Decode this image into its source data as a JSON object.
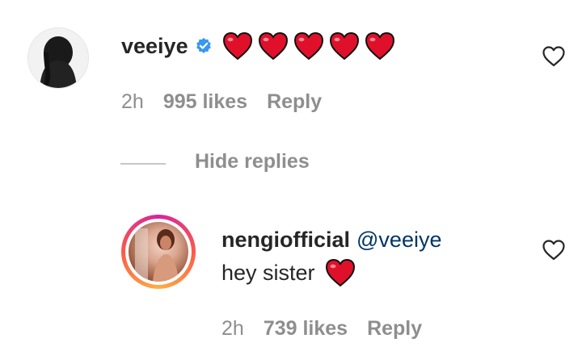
{
  "comment": {
    "username": "veeiye",
    "verified": true,
    "text": "❤️❤️❤️❤️❤️",
    "time": "2h",
    "likes": "995 likes",
    "reply_label": "Reply"
  },
  "replies_toggle": "Hide replies",
  "reply": {
    "username": "nengiofficial",
    "mention": "@veeiye",
    "text": "hey sister",
    "emoji": "❤️",
    "time": "2h",
    "likes": "739 likes",
    "reply_label": "Reply"
  },
  "colors": {
    "verified_badge": "#3897f0",
    "heart_emoji": "#e0102b",
    "mention": "#003569",
    "meta_text": "#8e8e8e"
  }
}
